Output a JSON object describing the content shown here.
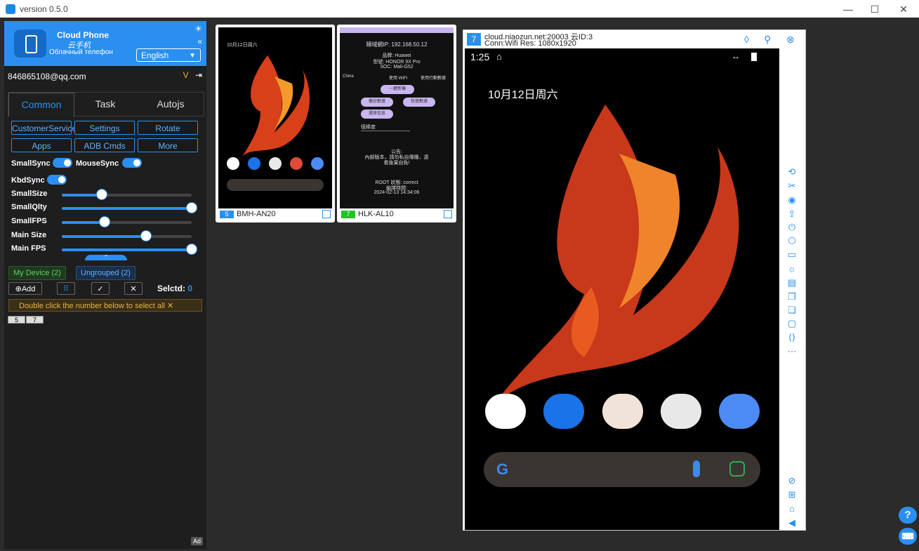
{
  "window": {
    "version": "version 0.5.0",
    "minimize": "—",
    "maximize": "☐",
    "close": "✕"
  },
  "brand": {
    "title_en": "Cloud Phone",
    "title_cn": "云手机",
    "title_ru": "Облачный телефон",
    "language": "English"
  },
  "account": {
    "email": "846865108@qq.com"
  },
  "tabs": [
    "Common",
    "Task",
    "Autojs"
  ],
  "buttons": {
    "row1": [
      "CustomerService",
      "Settings",
      "Rotate"
    ],
    "row2": [
      "Apps",
      "ADB Cmds",
      "More"
    ]
  },
  "toggles": {
    "small_sync": "SmallSync",
    "mouse_sync": "MouseSync",
    "kbd_sync": "KbdSync"
  },
  "sliders": [
    {
      "label": "SmallSize",
      "value": 0.31
    },
    {
      "label": "SmallQlty",
      "value": 1.0
    },
    {
      "label": "SmallFPS",
      "value": 0.33
    },
    {
      "label": "Main Size",
      "value": 0.65
    },
    {
      "label": "Main FPS",
      "value": 1.0
    }
  ],
  "groups": {
    "my_device": "My Device (2)",
    "ungrouped": "Ungrouped (2)"
  },
  "device_actions": {
    "add": "Add",
    "selected_label": "Selctd:",
    "selected_count": "0"
  },
  "hint": "Double click the number below to select all",
  "device_numbers": [
    "5",
    "7"
  ],
  "ad_label": "Ad",
  "devices": [
    {
      "number": "5",
      "name": "BMH-AN20",
      "badge_color": "#2a8ff0",
      "date": "10月12日周六"
    },
    {
      "number": "7",
      "name": "HLK-AL10",
      "badge_color": "#22c422",
      "ip": "隔域網IP: 192.168.50.12",
      "brand": "品牌: Huawei",
      "model": "型號: HONOR 9X Pro",
      "soc": "SOC: Mali-G52",
      "country": "China",
      "opt1": "使用 WIFI",
      "opt2": "使用行動數據",
      "btn1": "一鍵新機",
      "btn2": "備份數據",
      "btn3": "恢復數據",
      "btn4": "還原信息",
      "field": "徑緯度",
      "notice_title": "公告:",
      "notice1": "內部版本，請勿私自傳播，遠",
      "notice2": "看後果自負!",
      "root": "ROOT 狀態: correct",
      "compile_label": "編譯時間:",
      "compile_time": "2024-02-13 14:34:06"
    }
  ],
  "main_window": {
    "number": "7",
    "line1": "cloud.niaozun.net:20003 云ID:3",
    "line2": "Conn:Wifi Res: 1080x1920",
    "time": "1:25",
    "date": "10月12日周六"
  }
}
